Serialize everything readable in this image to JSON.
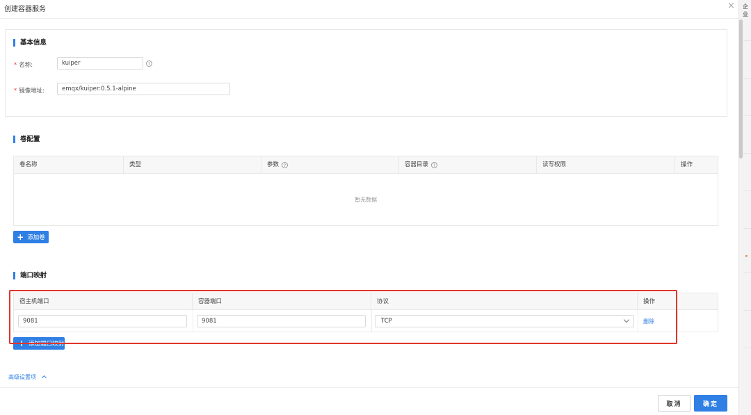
{
  "dialog": {
    "title": "创建容器服务",
    "close": "×"
  },
  "edge_text": "企业",
  "basic": {
    "title": "基本信息",
    "name_label": "名称:",
    "name_value": "kuiper",
    "image_label": "镜像地址:",
    "image_value": "emqx/kuiper:0.5.1-alpine"
  },
  "volume": {
    "title": "卷配置",
    "columns": [
      "卷名称",
      "类型",
      "参数",
      "容器目录",
      "读写权限",
      "操作"
    ],
    "empty_text": "暂无数据",
    "add_button": "添加卷"
  },
  "ports": {
    "title": "端口映射",
    "columns": [
      "宿主机端口",
      "容器端口",
      "协议",
      "操作"
    ],
    "rows": [
      {
        "host_port": "9081",
        "container_port": "9081",
        "protocol": "TCP",
        "delete": "删除"
      }
    ],
    "add_button": "添加端口映射"
  },
  "advanced": {
    "label": "高级设置项"
  },
  "footer": {
    "cancel": "取消",
    "ok": "确定"
  },
  "colors": {
    "primary": "#2f7fe4",
    "highlight": "#e0352b",
    "required": "#e8453c"
  }
}
